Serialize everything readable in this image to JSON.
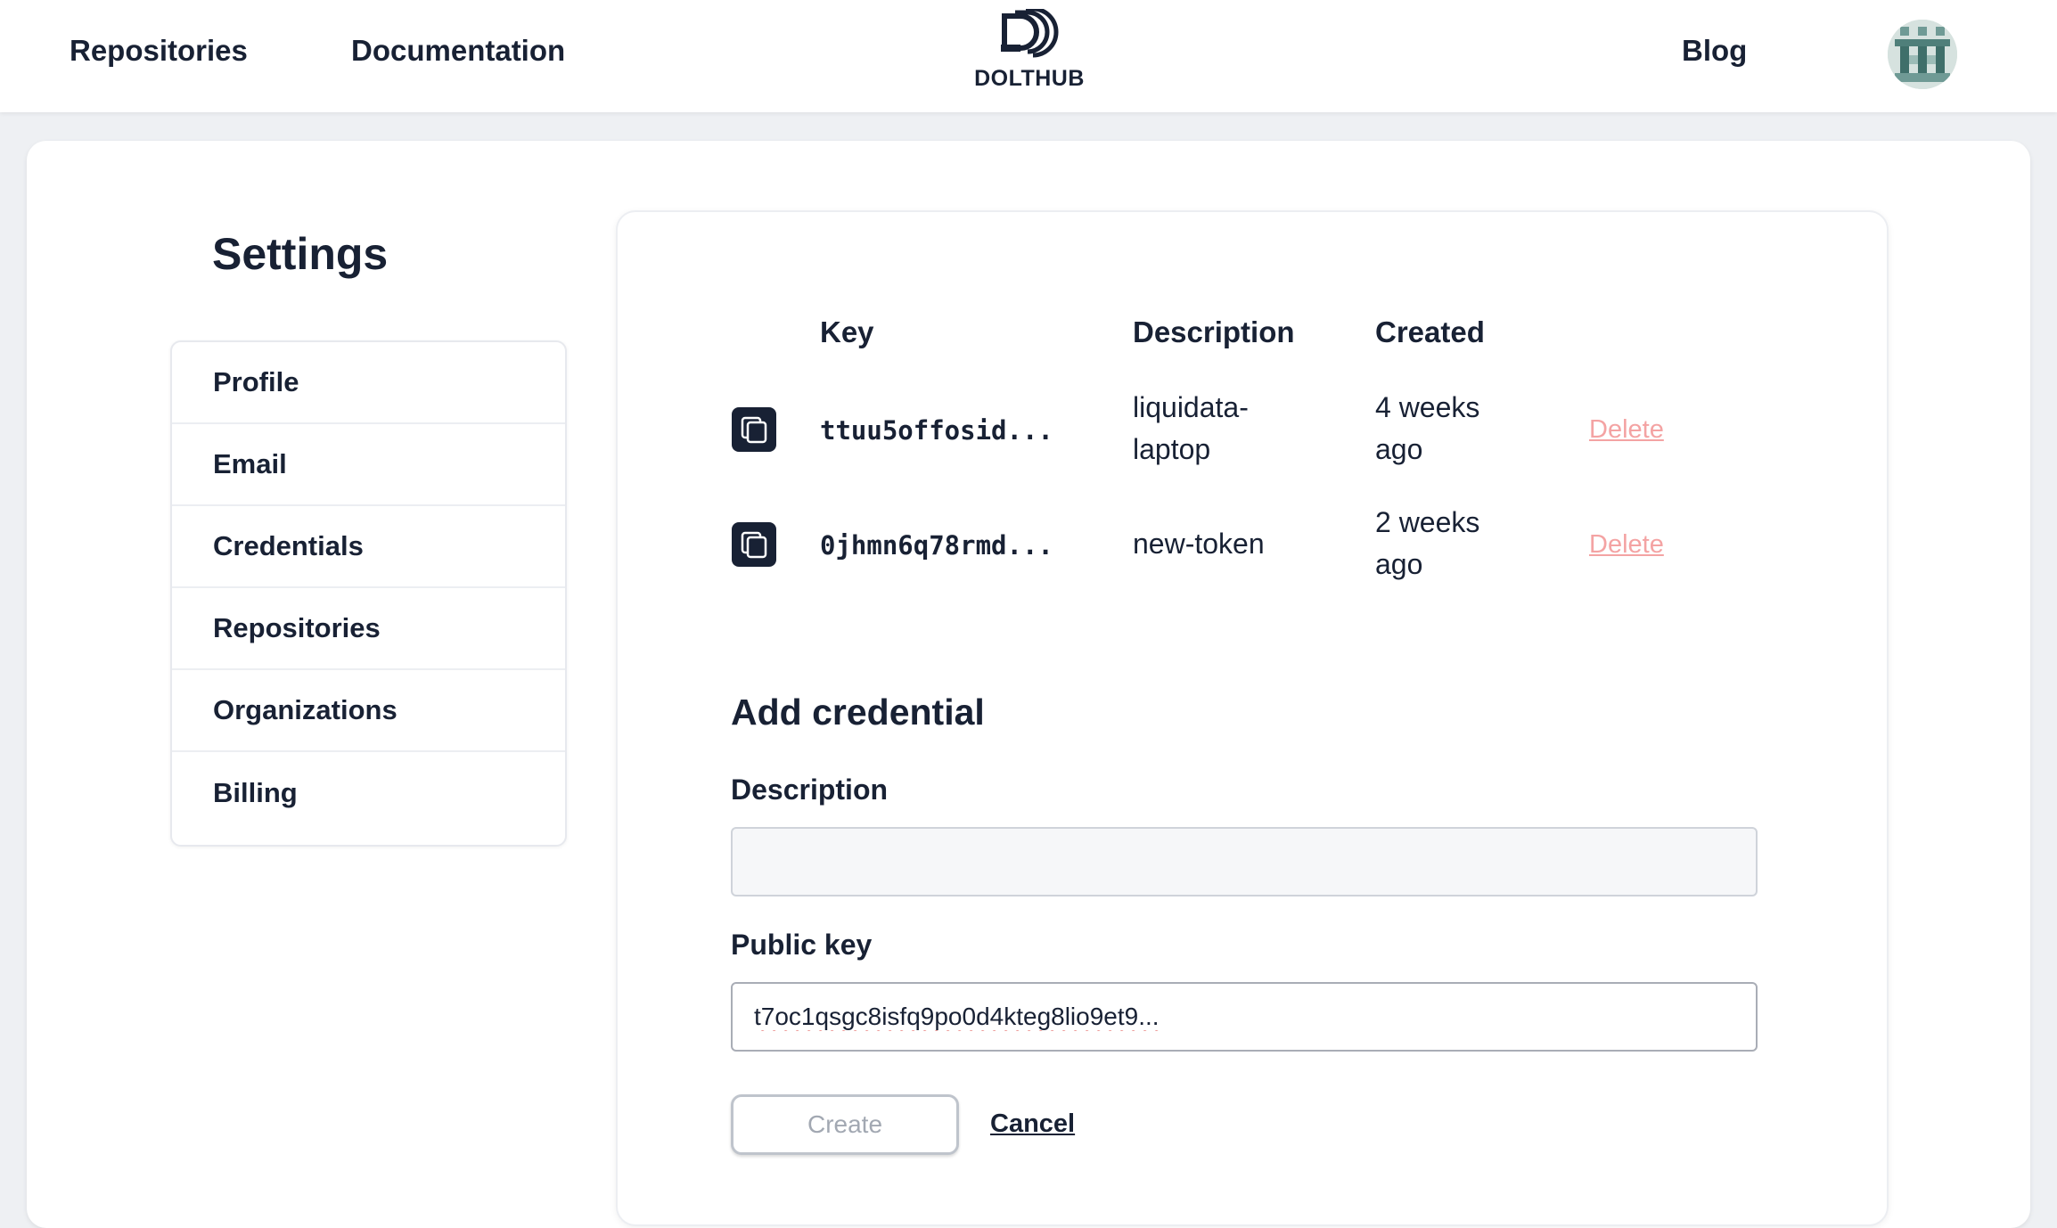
{
  "nav": {
    "repositories": "Repositories",
    "documentation": "Documentation",
    "logo_text": "DOLTHUB",
    "blog": "Blog"
  },
  "settings": {
    "title": "Settings",
    "menu": [
      "Profile",
      "Email",
      "Credentials",
      "Repositories",
      "Organizations",
      "Billing"
    ]
  },
  "credentials_table": {
    "headers": {
      "key": "Key",
      "description": "Description",
      "created": "Created"
    },
    "rows": [
      {
        "key": "ttuu5offosid...",
        "description": "liquidata-laptop",
        "created": "4 weeks ago",
        "action": "Delete"
      },
      {
        "key": "0jhmn6q78rmd...",
        "description": "new-token",
        "created": "2 weeks ago",
        "action": "Delete"
      }
    ]
  },
  "add_credential": {
    "title": "Add credential",
    "description_label": "Description",
    "description_value": "",
    "public_key_label": "Public key",
    "public_key_value": "t7oc1qsgc8isfq9po0d4kteg8lio9et9...",
    "create_label": "Create",
    "cancel_label": "Cancel"
  },
  "colors": {
    "primary_text": "#182134",
    "delete_link": "#f4a3a3",
    "disabled_button_text": "#a2a8b2"
  }
}
